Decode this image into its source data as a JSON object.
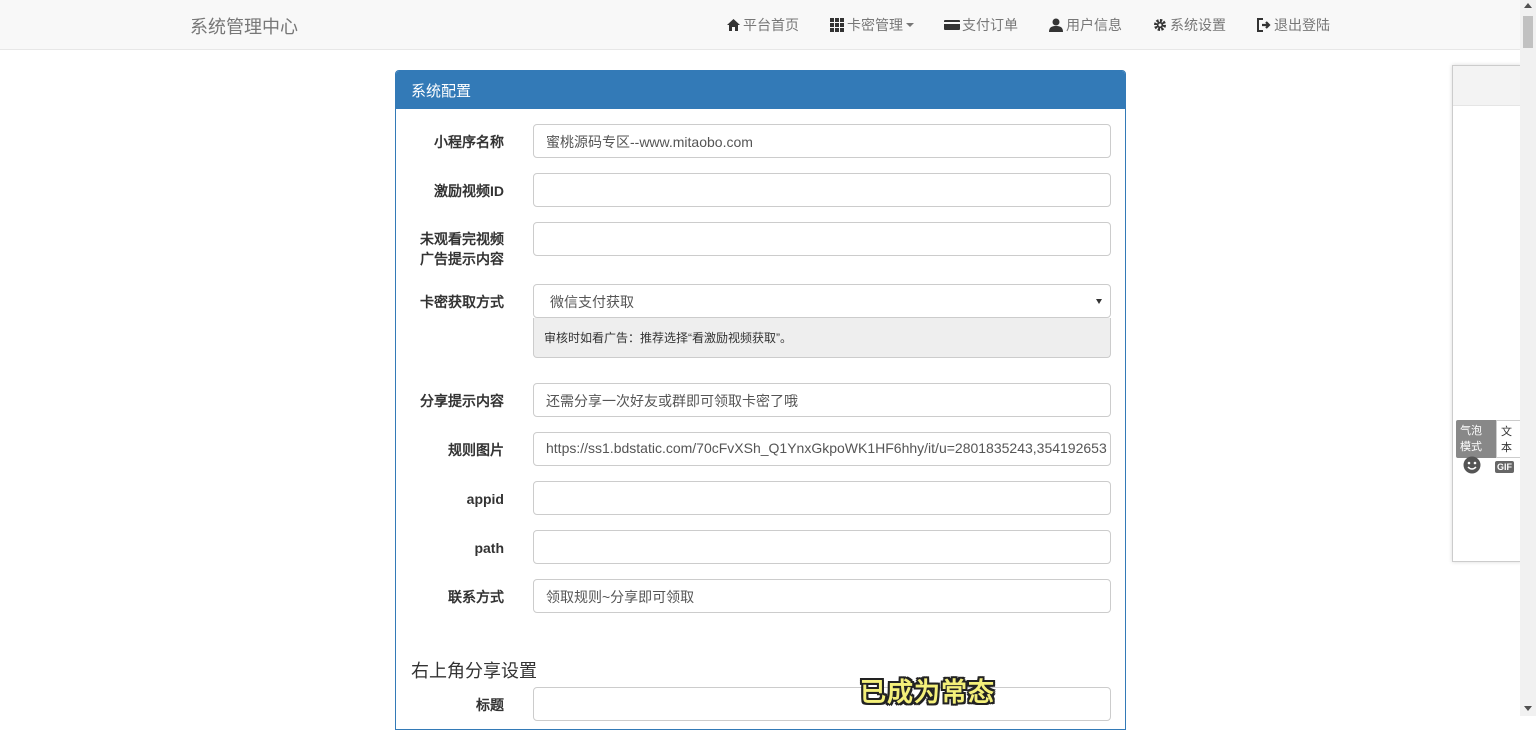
{
  "navbar": {
    "brand": "系统管理中心",
    "items": [
      {
        "label": "平台首页",
        "icon": "home-icon"
      },
      {
        "label": "卡密管理",
        "icon": "grid-icon",
        "dropdown": true
      },
      {
        "label": "支付订单",
        "icon": "card-icon"
      },
      {
        "label": "用户信息",
        "icon": "user-icon"
      },
      {
        "label": "系统设置",
        "icon": "gear-icon"
      },
      {
        "label": "退出登陆",
        "icon": "logout-icon"
      }
    ]
  },
  "panel": {
    "title": "系统配置",
    "fields": {
      "app_name": {
        "label": "小程序名称",
        "value": "蜜桃源码专区--www.mitaobo.com"
      },
      "reward_video_id": {
        "label": "激励视频ID",
        "value": ""
      },
      "unwatched_tip": {
        "label_line1": "未观看完视频",
        "label_line2": "广告提示内容",
        "value": ""
      },
      "card_method": {
        "label": "卡密获取方式",
        "value": "微信支付获取",
        "help": "审核时如看广告：推荐选择“看激励视频获取”。"
      },
      "share_tip": {
        "label": "分享提示内容",
        "value": "还需分享一次好友或群即可领取卡密了哦"
      },
      "rule_image": {
        "label": "规则图片",
        "value": "https://ss1.bdstatic.com/70cFvXSh_Q1YnxGkpoWK1HF6hhy/it/u=2801835243,354192653"
      },
      "appid": {
        "label": "appid",
        "value": ""
      },
      "path": {
        "label": "path",
        "value": ""
      },
      "contact": {
        "label": "联系方式",
        "value": "领取规则~分享即可领取"
      }
    },
    "share_section": {
      "title": "右上角分享设置",
      "title_field_label": "标题",
      "title_field_value": ""
    }
  },
  "widget": {
    "mode_on": "气泡模式",
    "mode_off": "文本",
    "gif_label": "GIF"
  },
  "subtitle": "已成为常态"
}
